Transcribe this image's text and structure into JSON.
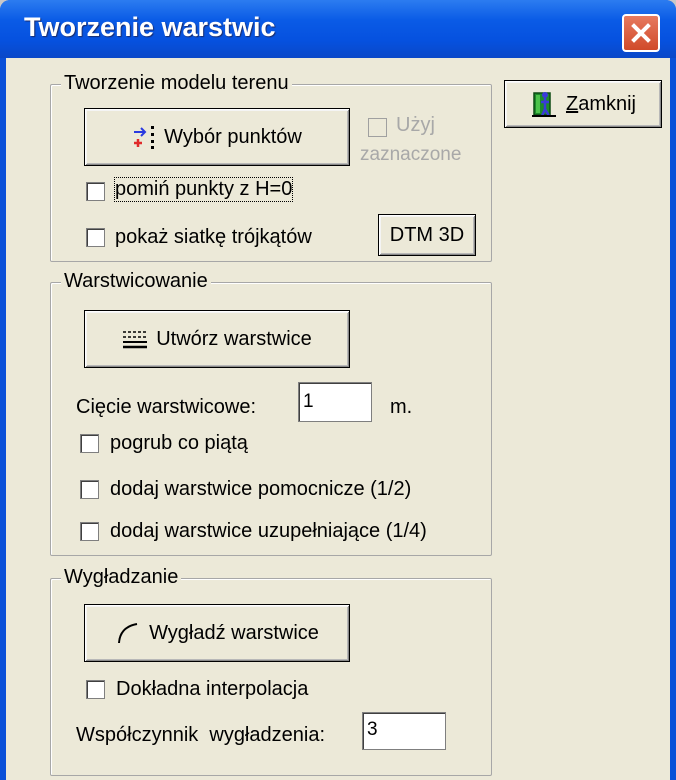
{
  "window": {
    "title": "Tworzenie warstwic",
    "close_icon": "close-x-icon"
  },
  "close_button": {
    "label": "Zamknij",
    "icon": "exit-door-icon"
  },
  "terrain_group": {
    "legend": "Tworzenie modelu terenu",
    "select_points_label": "Wybór punktów",
    "use_selected_label_1": "Użyj",
    "use_selected_label_2": "zaznaczone",
    "use_selected_checked": false,
    "skip_h0_label": "pomiń punkty z H=0",
    "skip_h0_checked": false,
    "show_triangle_label": "pokaż siatkę trójkątów",
    "show_triangle_checked": false,
    "dtm3d_label": "DTM 3D"
  },
  "contour_group": {
    "legend": "Warstwicowanie",
    "create_label": "Utwórz warstwice",
    "cut_label": "Cięcie warstwicowe:",
    "cut_value": "1",
    "cut_unit": "m.",
    "bold_fifth_label": "pogrub co piątą",
    "aux_label": "dodaj warstwice pomocnicze (1/2)",
    "supp_label": "dodaj warstwice uzupełniające (1/4)"
  },
  "smooth_group": {
    "legend": "Wygładzanie",
    "smooth_label": "Wygładź warstwice",
    "interp_label": "Dokładna interpolacja",
    "coef_label": "Współczynnik  wygładzenia:",
    "coef_value": "3"
  },
  "colors": {
    "title_bar": "#0a5be6",
    "dialog_bg": "#ece9d8",
    "close_button_red": "#d04a2a"
  }
}
